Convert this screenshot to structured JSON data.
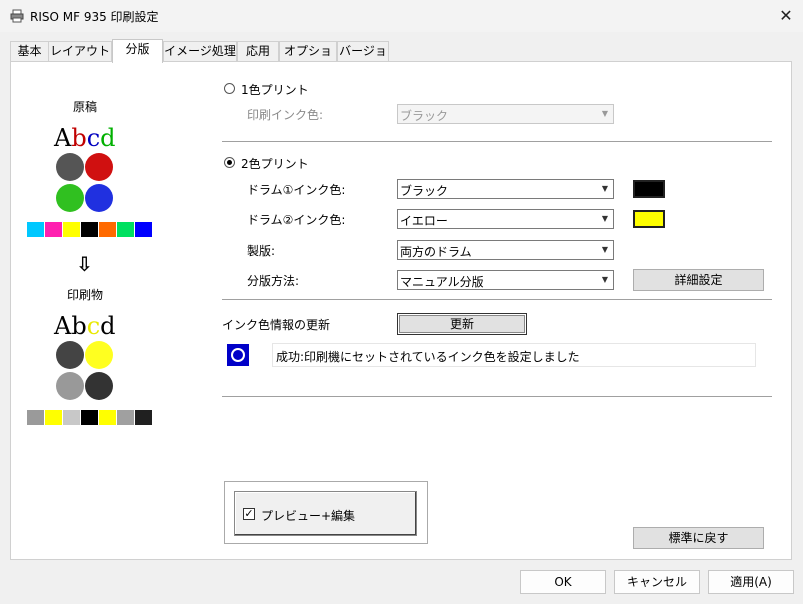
{
  "window": {
    "title": "RISO MF 935 印刷設定",
    "close": "✕"
  },
  "tabs": [
    "基本",
    "レイアウト",
    "分版",
    "イメージ処理",
    "応用",
    "オプション",
    "バージョン"
  ],
  "preview": {
    "original_label": "原稿",
    "output_label": "印刷物",
    "arrow": "⇩",
    "text_letters": [
      "A",
      "b",
      "c",
      "d"
    ],
    "original_letter_colors": [
      "#000000",
      "#c00000",
      "#0000c0",
      "#00b000"
    ],
    "output_letter_colors": [
      "#000000",
      "#000000",
      "#e8e800",
      "#000000"
    ],
    "original_strip": [
      "#00c8ff",
      "#ff20b0",
      "#ffff00",
      "#000000",
      "#ff6a00",
      "#00e060",
      "#0000ff"
    ],
    "output_strip": [
      "#9a9a9a",
      "#ffff00",
      "#c8c8c8",
      "#000000",
      "#ffff00",
      "#a0a0a0",
      "#202020"
    ],
    "original_apples": [
      "#555555",
      "#d01010",
      "#30c020",
      "#2030e0"
    ],
    "output_apples": [
      "#444444",
      "#ffff20",
      "#999999",
      "#333333"
    ]
  },
  "one_color": {
    "label": "1色プリント",
    "selected": false,
    "ink_label": "印刷インク色:",
    "ink_value": "ブラック"
  },
  "two_color": {
    "label": "2色プリント",
    "selected": true,
    "drum1_label": "ドラム①インク色:",
    "drum1_value": "ブラック",
    "drum1_color": "#000000",
    "drum2_label": "ドラム②インク色:",
    "drum2_value": "イエロー",
    "drum2_color": "#ffff00",
    "plate_label": "製版:",
    "plate_value": "両方のドラム",
    "separation_label": "分版方法:",
    "separation_value": "マニュアル分版",
    "details_button": "詳細設定"
  },
  "ink_update": {
    "label": "インク色情報の更新",
    "button": "更新",
    "status_text": "成功:印刷機にセットされているインク色を設定しました"
  },
  "preview_edit": {
    "label": "プレビュー+編集",
    "checked": true,
    "check_mark": "✓"
  },
  "restore_default": "標準に戻す",
  "footer": {
    "ok": "OK",
    "cancel": "キャンセル",
    "apply": "適用(A)"
  }
}
